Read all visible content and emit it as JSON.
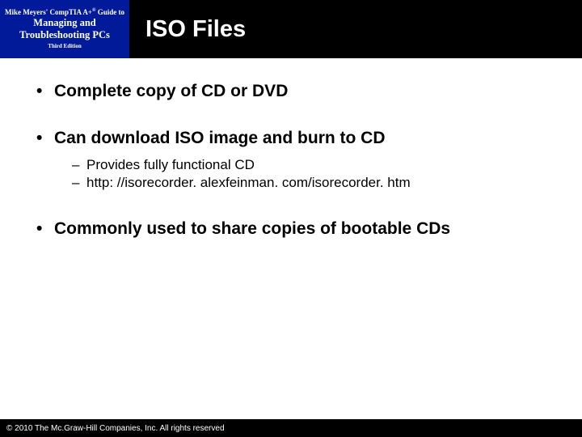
{
  "header": {
    "book": {
      "line1_pre": "Mike Meyers' Comp",
      "line1_tia": "TIA",
      "line1_aplus": "A+",
      "line1_reg": "®",
      "line1_guide": " Guide to",
      "line2a": "Managing and",
      "line2b": "Troubleshooting PCs",
      "edition": "Third Edition"
    },
    "title": "ISO Files"
  },
  "bullets": [
    {
      "text": "Complete copy of CD or DVD",
      "sub": []
    },
    {
      "text": "Can download ISO image and burn to CD",
      "sub": [
        "Provides fully functional CD",
        "http: //isorecorder. alexfeinman. com/isorecorder. htm"
      ]
    },
    {
      "text": "Commonly used to share copies of bootable CDs",
      "sub": []
    }
  ],
  "footer": "© 2010 The Mc.Graw-Hill Companies, Inc. All rights reserved"
}
